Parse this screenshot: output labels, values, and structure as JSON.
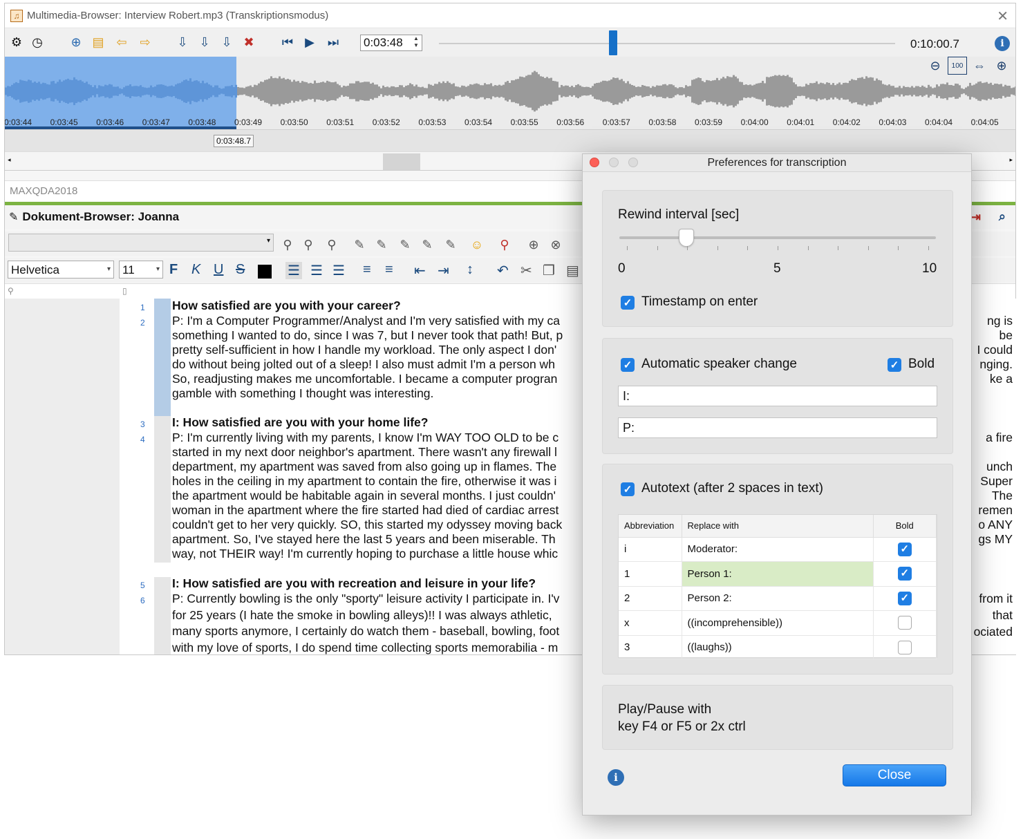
{
  "mm_window": {
    "title": "Multimedia-Browser:  Interview Robert.mp3 (Transkriptionsmodus)",
    "current_time": "0:03:48",
    "end_time": "0:10:00.7",
    "playhead_label": "0:03:48.7",
    "ticks": [
      "0:03:44",
      "0:03:45",
      "0:03:46",
      "0:03:47",
      "0:03:48",
      "0:03:49",
      "0:03:50",
      "0:03:51",
      "0:03:52",
      "0:03:53",
      "0:03:54",
      "0:03:55",
      "0:03:56",
      "0:03:57",
      "0:03:58",
      "0:03:59",
      "0:04:00",
      "0:04:01",
      "0:04:02",
      "0:04:03",
      "0:04:04",
      "0:04:05"
    ],
    "zoom_labels": [
      "zoom-out",
      "100",
      "fit",
      "zoom-in"
    ],
    "selection_color": "#7fb0ea"
  },
  "maxqda": {
    "label": "MAXQDA2018"
  },
  "doc": {
    "header": "Dokument-Browser: Joanna",
    "font": "Helvetica",
    "size": "11"
  },
  "paragraphs": [
    {
      "num": "1",
      "clock": true,
      "bold": true,
      "lines": [
        "How satisfied are you with your career?"
      ]
    },
    {
      "num": "2",
      "lines": [
        "P: I'm a Computer Programmer/Analyst and I'm very satisfied with my ca",
        "something I wanted to do, since I was 7, but I never took that path!  But, p",
        "pretty self-sufficient in how I handle my workload.  The only aspect I don'",
        "do without being jolted out of a sleep!  I also must admit I'm a person wh",
        "So, readjusting makes me uncomfortable.  I became a computer progran",
        "gamble with something I thought was interesting."
      ]
    },
    {
      "num": "3",
      "clock": true,
      "bold": true,
      "lines": [
        "I: How satisfied are you with your home life?"
      ]
    },
    {
      "num": "4",
      "lines": [
        "P: I'm currently living with my parents, I know I'm WAY TOO OLD to be c",
        "started in my next door neighbor's apartment.  There wasn't any firewall l",
        "department, my apartment was saved from also going up in flames.  The",
        "holes in the ceiling in my apartment to contain the fire, otherwise it was i",
        "the apartment would be habitable again in several months.  I just couldn'",
        "woman in the apartment where the fire started had died of cardiac arrest",
        "couldn't get to her very quickly.  SO, this started my odyssey moving back",
        "apartment.  So, I've stayed here the last 5 years and been miserable.  Th",
        "way, not THEIR way!  I'm currently hoping to purchase a little house whic"
      ]
    },
    {
      "num": "5",
      "clock": true,
      "bold": true,
      "lines": [
        "I: How satisfied are you with recreation and leisure in your life?"
      ]
    },
    {
      "num": "6",
      "lines": [
        "P: Currently bowling is the only \"sporty\" leisure activity I participate in.  I'v",
        "for 25 years (I hate the smoke in bowling alleys)!!  I was always athletic, ",
        "many sports anymore, I certainly do watch them - baseball, bowling, foot",
        "with my love of sports, I do spend time collecting sports memorabilia - m"
      ]
    }
  ],
  "right_fragments": [
    "ng is",
    "be",
    "I could",
    "nging.",
    "ke a",
    "a fire",
    "unch",
    "Super",
    "The",
    "remen",
    "o ANY",
    "gs MY",
    "from it",
    "that",
    "ociated"
  ],
  "dialog": {
    "title": "Preferences for transcription",
    "rewind_label": "Rewind interval [sec]",
    "rewind_value": 2,
    "rewind_min": "0",
    "rewind_mid": "5",
    "rewind_max": "10",
    "timestamp_label": "Timestamp on enter",
    "timestamp_checked": true,
    "speaker_label": "Automatic speaker change",
    "speaker_checked": true,
    "bold_label": "Bold",
    "bold_checked": true,
    "speaker1": "I:",
    "speaker2": "P:",
    "autotext_label": "Autotext (after 2 spaces in text)",
    "autotext_checked": true,
    "table_headers": [
      "Abbreviation",
      "Replace with",
      "Bold"
    ],
    "table_rows": [
      {
        "abbr": "i",
        "replace": "Moderator:",
        "bold": true
      },
      {
        "abbr": "1",
        "replace": "Person 1:",
        "bold": true
      },
      {
        "abbr": "2",
        "replace": "Person 2:",
        "bold": true
      },
      {
        "abbr": "x",
        "replace": "((incomprehensible))",
        "bold": false
      },
      {
        "abbr": "3",
        "replace": "((laughs))",
        "bold": false
      }
    ],
    "playpause_line1": "Play/Pause with",
    "playpause_line2": "key F4 or F5 or 2x ctrl",
    "close_label": "Close",
    "accent_color": "#1f7ee3"
  }
}
